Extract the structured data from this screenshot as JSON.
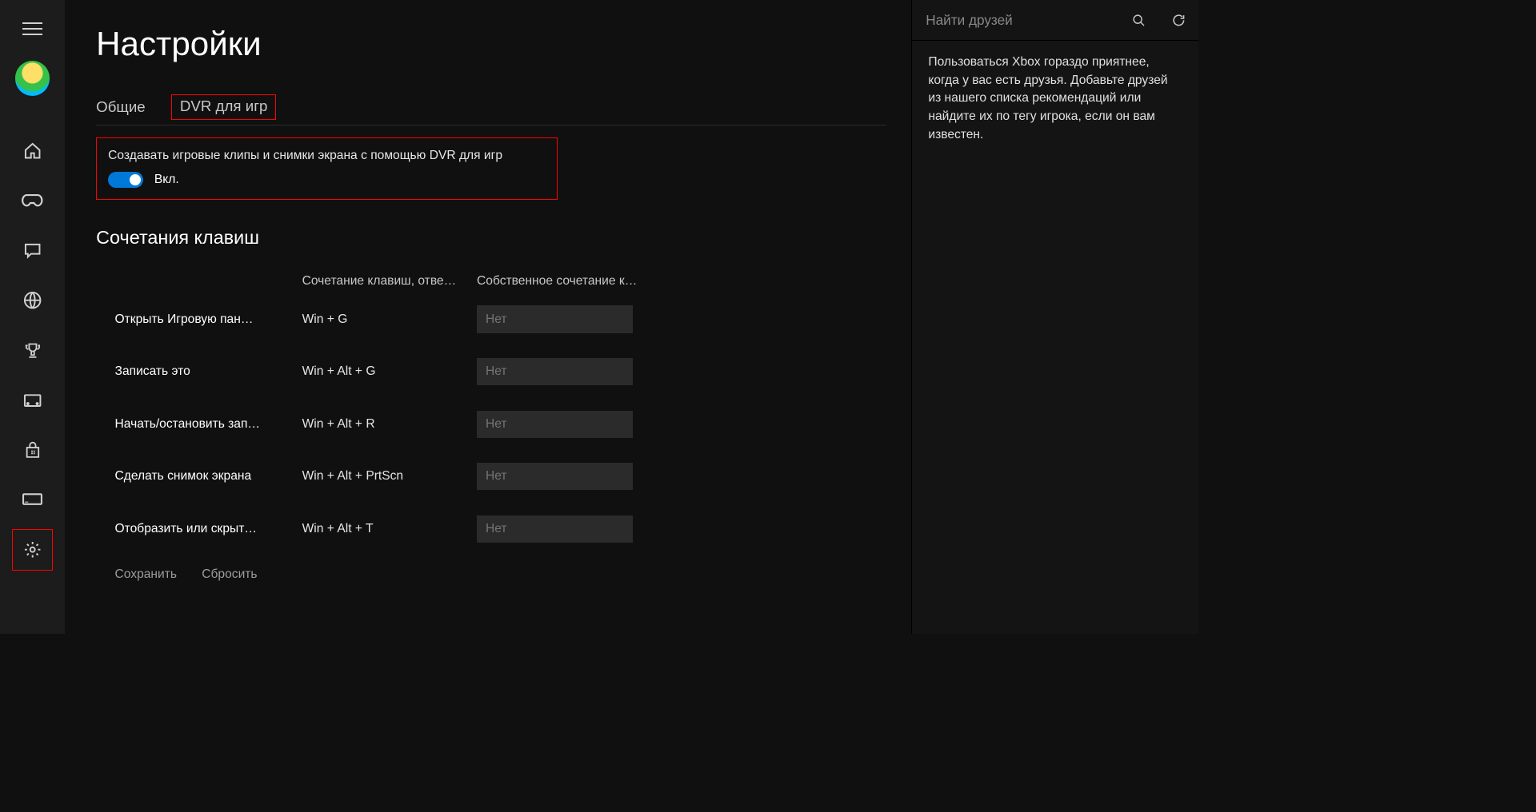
{
  "page_title": "Настройки",
  "tabs": {
    "general": "Общие",
    "dvr": "DVR для игр"
  },
  "dvr": {
    "description": "Создавать игровые клипы и снимки экрана с помощью DVR для игр",
    "toggle_state": "Вкл."
  },
  "shortcuts": {
    "section_title": "Сочетания клавиш",
    "header_preset": "Сочетание клавиш, отве…",
    "header_custom": "Собственное сочетание к…",
    "rows": [
      {
        "name": "Открыть Игровую пан…",
        "preset": "Win + G",
        "custom_placeholder": "Нет"
      },
      {
        "name": "Записать это",
        "preset": "Win + Alt + G",
        "custom_placeholder": "Нет"
      },
      {
        "name": "Начать/остановить зап…",
        "preset": "Win + Alt + R",
        "custom_placeholder": "Нет"
      },
      {
        "name": "Сделать снимок экрана",
        "preset": "Win + Alt + PrtScn",
        "custom_placeholder": "Нет"
      },
      {
        "name": "Отобразить или скрыт…",
        "preset": "Win + Alt + T",
        "custom_placeholder": "Нет"
      }
    ]
  },
  "footer": {
    "save": "Сохранить",
    "reset": "Сбросить"
  },
  "friends": {
    "search_placeholder": "Найти друзей",
    "blurb": "Пользоваться Xbox гораздо приятнее, когда у вас есть друзья. Добавьте друзей из нашего списка рекомендаций или найдите их по тегу игрока, если он вам известен."
  }
}
